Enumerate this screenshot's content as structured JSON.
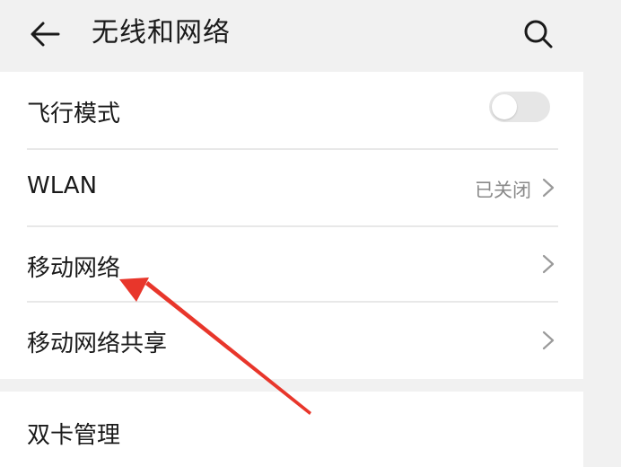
{
  "header": {
    "title": "无线和网络",
    "back_icon": "back-arrow-icon",
    "search_icon": "search-icon"
  },
  "settings": [
    {
      "label": "飞行模式",
      "control": "toggle",
      "toggle_on": false
    },
    {
      "label": "WLAN",
      "status": "已关闭",
      "control": "chevron"
    },
    {
      "label": "移动网络",
      "control": "chevron"
    },
    {
      "label": "移动网络共享",
      "control": "chevron"
    }
  ],
  "second_group": [
    {
      "label": "双卡管理"
    }
  ],
  "colors": {
    "background": "#f1f1f1",
    "card": "#ffffff",
    "text": "#1a1a1a",
    "secondary_text": "#8a8a8a",
    "annotation_arrow": "#e8362b"
  },
  "annotation": {
    "type": "arrow",
    "points_to": "移动网络"
  }
}
